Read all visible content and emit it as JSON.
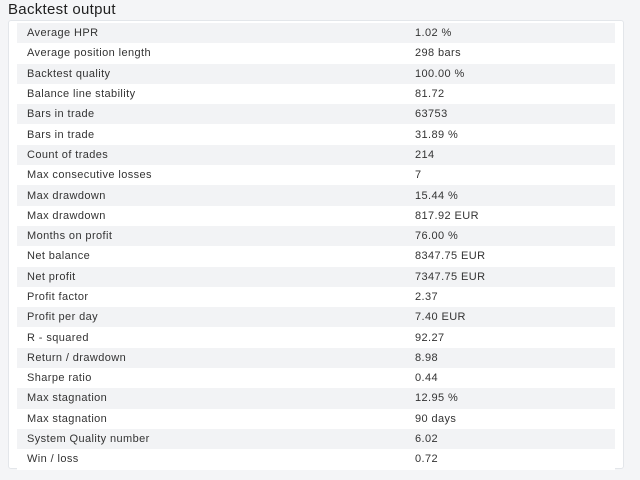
{
  "title": "Backtest output",
  "rows": [
    {
      "label": "Average HPR",
      "value": "1.02 %"
    },
    {
      "label": "Average position length",
      "value": "298 bars"
    },
    {
      "label": "Backtest quality",
      "value": "100.00 %"
    },
    {
      "label": "Balance line stability",
      "value": "81.72"
    },
    {
      "label": "Bars in trade",
      "value": "63753"
    },
    {
      "label": "Bars in trade",
      "value": "31.89 %"
    },
    {
      "label": "Count of trades",
      "value": "214"
    },
    {
      "label": "Max consecutive losses",
      "value": "7"
    },
    {
      "label": "Max drawdown",
      "value": "15.44 %"
    },
    {
      "label": "Max drawdown",
      "value": "817.92 EUR"
    },
    {
      "label": "Months on profit",
      "value": "76.00 %"
    },
    {
      "label": "Net balance",
      "value": "8347.75 EUR"
    },
    {
      "label": "Net profit",
      "value": "7347.75 EUR"
    },
    {
      "label": "Profit factor",
      "value": "2.37"
    },
    {
      "label": "Profit per day",
      "value": "7.40 EUR"
    },
    {
      "label": "R - squared",
      "value": "92.27"
    },
    {
      "label": "Return / drawdown",
      "value": "8.98"
    },
    {
      "label": "Sharpe ratio",
      "value": "0.44"
    },
    {
      "label": "Max stagnation",
      "value": "12.95 %"
    },
    {
      "label": "Max stagnation",
      "value": "90 days"
    },
    {
      "label": "System Quality number",
      "value": "6.02"
    },
    {
      "label": "Win / loss",
      "value": "0.72"
    }
  ]
}
